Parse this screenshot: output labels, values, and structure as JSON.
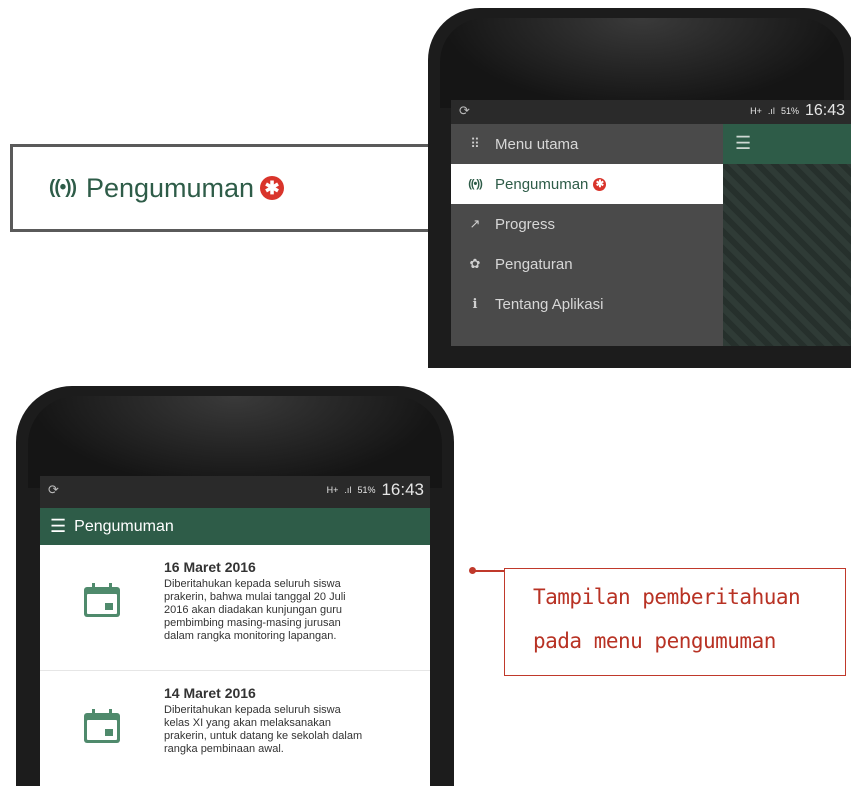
{
  "callout": {
    "label": "Pengumuman",
    "broadcast_glyph": "((•))",
    "badge_glyph": "✱"
  },
  "status_bar": {
    "network": "H+",
    "signal": ".ıl",
    "battery": "51%",
    "time": "16:43",
    "refresh_glyph": "⟳"
  },
  "drawer": {
    "items": [
      {
        "icon": "grid-icon",
        "glyph": "⠿",
        "label": "Menu utama",
        "active": false
      },
      {
        "icon": "broadcast-icon",
        "glyph": "((•))",
        "label": "Pengumuman",
        "active": true
      },
      {
        "icon": "trend-icon",
        "glyph": "↗",
        "label": "Progress",
        "active": false
      },
      {
        "icon": "gear-icon",
        "glyph": "✿",
        "label": "Pengaturan",
        "active": false
      },
      {
        "icon": "info-icon",
        "glyph": "i",
        "label": "Tentang Aplikasi",
        "active": false
      }
    ]
  },
  "app_bar": {
    "title": "Pengumuman",
    "menu_glyph": "☰"
  },
  "announcements": [
    {
      "date": "16 Maret 2016",
      "body": "Diberitahukan kepada seluruh siswa prakerin, bahwa mulai tanggal 20 Juli 2016 akan diadakan kunjungan guru pembimbing masing-masing jurusan dalam rangka monitoring lapangan."
    },
    {
      "date": "14 Maret 2016",
      "body": "Diberitahukan kepada seluruh siswa kelas XI yang akan melaksanakan prakerin, untuk datang ke sekolah dalam rangka pembinaan awal."
    }
  ],
  "caption": {
    "line1": "Tampilan pemberitahuan",
    "line2": "pada menu pengumuman"
  },
  "colors": {
    "primary": "#2e5c48",
    "badge": "#d9342b",
    "caption": "#b83224"
  }
}
